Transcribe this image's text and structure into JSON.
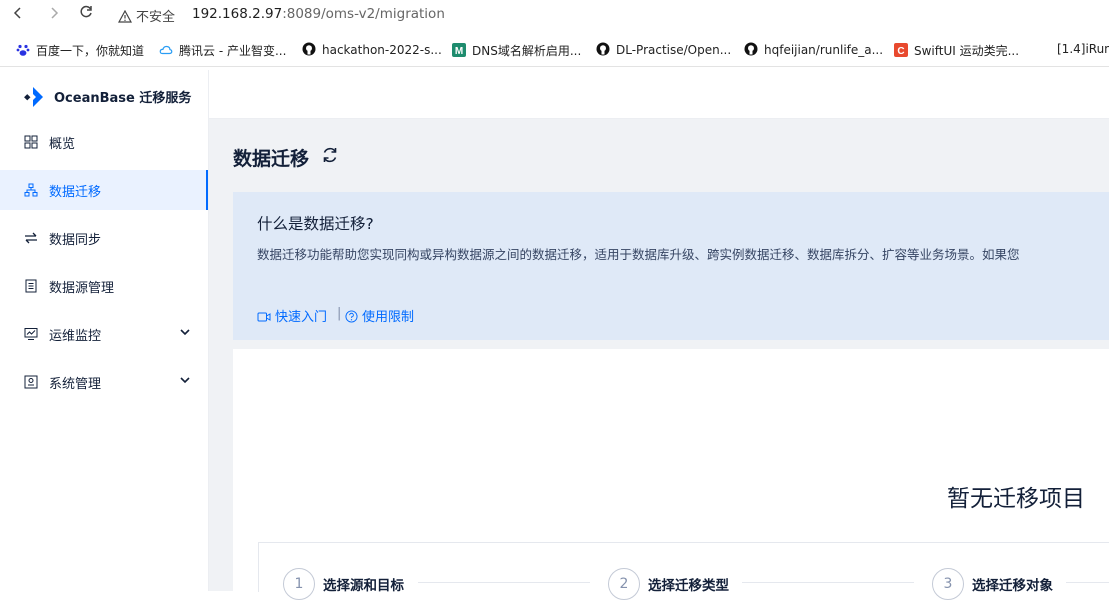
{
  "browser": {
    "security_label": "不安全",
    "url_host": "192.168.2.97",
    "url_path": ":8089/oms-v2/migration",
    "bookmarks": [
      {
        "label": "百度一下，你就知道",
        "icon": "baidu-paw-icon"
      },
      {
        "label": "腾讯云 - 产业智变...",
        "icon": "tencent-cloud-icon"
      },
      {
        "label": "hackathon-2022-s...",
        "icon": "github-icon"
      },
      {
        "label": "DNS域名解析启用...",
        "icon": "m-logo-icon"
      },
      {
        "label": "DL-Practise/Open...",
        "icon": "github-icon"
      },
      {
        "label": "hqfeijian/runlife_a...",
        "icon": "github-icon"
      },
      {
        "label": "SwiftUI 运动类完...",
        "icon": "csdn-icon"
      },
      {
        "label": "[1.4]iRun",
        "icon": ""
      }
    ]
  },
  "app": {
    "logo_text": "OceanBase 迁移服务",
    "brand_color": "#006aff"
  },
  "sidebar": {
    "items": [
      {
        "label": "概览",
        "icon": "grid-icon"
      },
      {
        "label": "数据迁移",
        "icon": "org-chart-icon",
        "active": true
      },
      {
        "label": "数据同步",
        "icon": "sync-arrows-icon"
      },
      {
        "label": "数据源管理",
        "icon": "database-doc-icon"
      },
      {
        "label": "运维监控",
        "icon": "monitor-icon",
        "expandable": true
      },
      {
        "label": "系统管理",
        "icon": "admin-panel-icon",
        "expandable": true
      }
    ]
  },
  "page": {
    "title": "数据迁移",
    "intro_title": "什么是数据迁移?",
    "intro_desc": "数据迁移功能帮助您实现同构或异构数据源之间的数据迁移，适用于数据库升级、跨实例数据迁移、数据库拆分、扩容等业务场景。如果您",
    "link_quickstart": "快速入门",
    "link_separator": "|",
    "link_limits": "使用限制",
    "empty_title": "暂无迁移项目",
    "steps": [
      {
        "num": "1",
        "label": "选择源和目标"
      },
      {
        "num": "2",
        "label": "选择迁移类型"
      },
      {
        "num": "3",
        "label": "选择迁移对象"
      }
    ]
  }
}
